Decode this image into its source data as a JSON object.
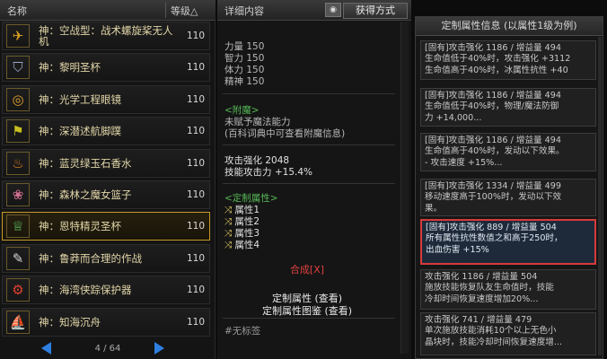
{
  "list_header": {
    "name": "名称",
    "level": "等级△"
  },
  "items": [
    {
      "name": "神：空战型：战术螺旋桨无人机",
      "level": "110",
      "icon": "drone-icon",
      "glyph": "✈",
      "color": "#d8a020"
    },
    {
      "name": "神：黎明圣杯",
      "level": "110",
      "icon": "grail-icon",
      "glyph": "⛉",
      "color": "#9aa8c8"
    },
    {
      "name": "神：光学工程眼镜",
      "level": "110",
      "icon": "goggles-icon",
      "glyph": "◎",
      "color": "#e0a030"
    },
    {
      "name": "神：深潜述航脚蹼",
      "level": "110",
      "icon": "flipper-icon",
      "glyph": "⚑",
      "color": "#c8c020"
    },
    {
      "name": "神：蓝灵绿玉石香水",
      "level": "110",
      "icon": "perfume-icon",
      "glyph": "♨",
      "color": "#e08020"
    },
    {
      "name": "神：森林之魔女篮子",
      "level": "110",
      "icon": "basket-icon",
      "glyph": "❀",
      "color": "#d07090"
    },
    {
      "name": "神：恩特精灵圣杯",
      "level": "110",
      "icon": "chalice-icon",
      "glyph": "♕",
      "color": "#60c060"
    },
    {
      "name": "神：鲁莽而合理的作战",
      "level": "110",
      "icon": "scroll-icon",
      "glyph": "✎",
      "color": "#d8d8d8"
    },
    {
      "name": "神：海湾侠踪保护器",
      "level": "110",
      "icon": "protector-icon",
      "glyph": "⚙",
      "color": "#e04030"
    },
    {
      "name": "神：知海沉舟",
      "level": "110",
      "icon": "boat-icon",
      "glyph": "⛵",
      "color": "#e0b060"
    }
  ],
  "selected_index": 6,
  "pager": {
    "text": "4 / 64"
  },
  "detail": {
    "header": "详细内容",
    "eye_label": "◉",
    "obtain_button": "获得方式",
    "stats": [
      "力量 150",
      "智力 150",
      "体力 150",
      "精神 150"
    ],
    "enchant_title": "<附魔>",
    "enchant_line1": "未赋予魔法能力",
    "enchant_line2": "(百科词典中可查看附魔信息)",
    "atk_strength": "攻击强化 2048",
    "skill_atk": "技能攻击力 +15.4%",
    "custom_title": "<定制属性>",
    "custom_props": [
      "属性1",
      "属性2",
      "属性3",
      "属性4"
    ],
    "compose": "合成[X]",
    "custom_view": "定制属性 (查看)",
    "custom_atlas": "定制属性图鉴 (查看)",
    "tag": "#无标签"
  },
  "right_panel": {
    "title": "定制属性信息 (以属性1级为例)",
    "cards": [
      {
        "lines": [
          "[固有]攻击强化 1186 / 增益量 494",
          "生命值低于40%时，攻击强化 +3112",
          "生命值高于40%时，冰属性抗性 +40"
        ]
      },
      {
        "lines": [
          "[固有]攻击强化 1186 / 增益量 494",
          "生命值低于40%时，物理/魔法防御",
          "力 +14,000..."
        ]
      },
      {
        "lines": [
          "[固有]攻击强化 1186 / 增益量 494",
          "生命值高于40%时，发动以下效果。",
          "- 攻击速度 +15%..."
        ]
      },
      {
        "lines": [
          "[固有]攻击强化 1334 / 增益量 499",
          "移动速度高于100%时，发动以下效",
          "果。"
        ]
      },
      {
        "lines": [
          "[固有]攻击强化 889 / 增益量 504",
          "所有属性抗性数值之和高于250时，",
          "出血伤害 +15%"
        ],
        "highlight": true
      },
      {
        "lines": [
          "攻击强化 1186 / 增益量 504",
          "施放技能恢复队友生命值时，技能",
          "冷却时间恢复速度增加20%..."
        ]
      },
      {
        "lines": [
          "攻击强化 741 / 增益量 479",
          "单次施放技能消耗10个以上无色小",
          "晶块时，技能冷却时间恢复速度增..."
        ]
      }
    ]
  }
}
